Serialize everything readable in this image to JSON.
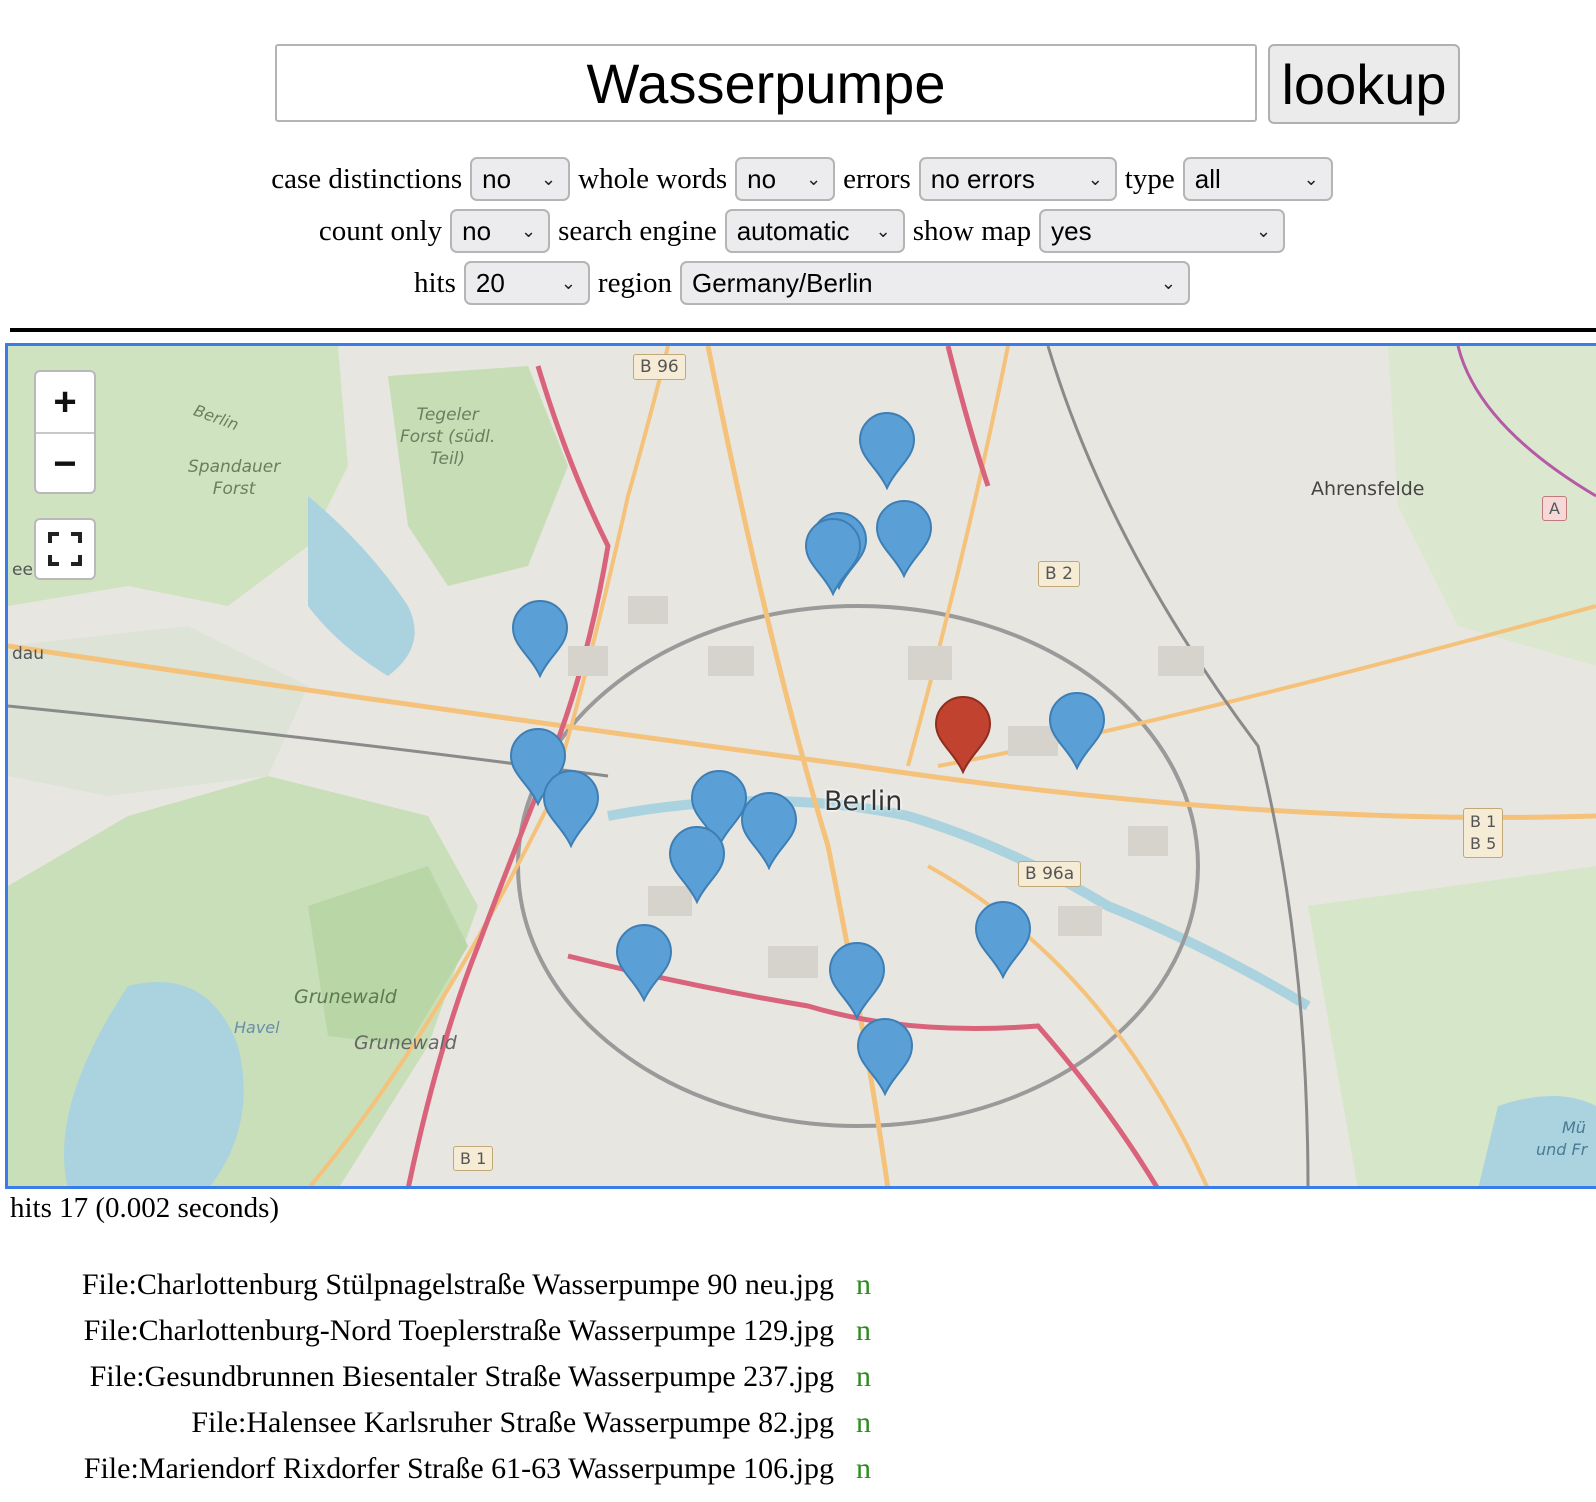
{
  "search": {
    "query": "Wasserpumpe",
    "button_label": "lookup"
  },
  "options": {
    "case_distinctions": {
      "label": "case distinctions",
      "value": "no"
    },
    "whole_words": {
      "label": "whole words",
      "value": "no"
    },
    "errors": {
      "label": "errors",
      "value": "no errors"
    },
    "type": {
      "label": "type",
      "value": "all"
    },
    "count_only": {
      "label": "count only",
      "value": "no"
    },
    "search_engine": {
      "label": "search engine",
      "value": "automatic"
    },
    "show_map": {
      "label": "show map",
      "value": "yes"
    },
    "hits": {
      "label": "hits",
      "value": "20"
    },
    "region": {
      "label": "region",
      "value": "Germany/Berlin"
    }
  },
  "map": {
    "zoom_in": "+",
    "zoom_out": "−",
    "city_label": "Berlin",
    "place_labels": [
      "Tegeler",
      "Forst (südl.",
      "Teil)",
      "Spandauer",
      "Forst",
      "Berlin",
      "Ahrensfelde",
      "Grunewald",
      "Grunewald",
      "Havel",
      "dau",
      "ee",
      "Mü",
      "und Fr"
    ],
    "road_labels": [
      "B 96",
      "B 2",
      "B 96a",
      "B 1",
      "B 5",
      "B 1",
      "A"
    ],
    "marker_colors": {
      "hit": "#5a9fd6",
      "selected": "#c1432f"
    }
  },
  "status": "hits 17 (0.002 seconds)",
  "results": [
    {
      "file": "File:Charlottenburg Stülpnagelstraße Wasserpumpe 90 neu.jpg",
      "flag": "n"
    },
    {
      "file": "File:Charlottenburg-Nord Toeplerstraße Wasserpumpe 129.jpg",
      "flag": "n"
    },
    {
      "file": "File:Gesundbrunnen Biesentaler Straße Wasserpumpe 237.jpg",
      "flag": "n"
    },
    {
      "file": "File:Halensee Karlsruher Straße Wasserpumpe 82.jpg",
      "flag": "n"
    },
    {
      "file": "File:Mariendorf Rixdorfer Straße 61-63 Wasserpumpe 106.jpg",
      "flag": "n"
    }
  ]
}
